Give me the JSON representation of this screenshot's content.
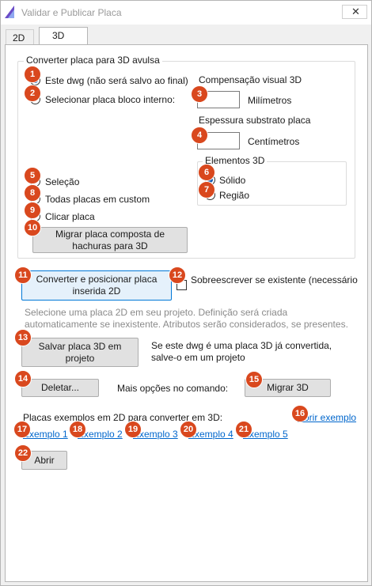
{
  "window": {
    "title": "Validar e Publicar Placa",
    "close_glyph": "✕",
    "icon": "app-triangle-icon"
  },
  "tabs": [
    {
      "label": "2D"
    },
    {
      "label": "3D"
    }
  ],
  "convert_group": {
    "legend": "Converter placa para 3D avulsa",
    "opt_this_dwg": "Este dwg (não será salvo ao final)",
    "opt_internal_block": "Selecionar placa bloco interno:",
    "visual_comp_label": "Compensação visual 3D",
    "visual_comp_value": "",
    "visual_comp_unit": "Milímetros",
    "substrate_label": "Espessura substrato placa",
    "substrate_value": "",
    "substrate_unit": "Centímetros",
    "elements_legend": "Elementos 3D",
    "opt_solid": "Sólido",
    "opt_region": "Região",
    "opt_selection": "Seleção",
    "opt_all_custom": "Todas placas em custom",
    "opt_click": "Clicar placa",
    "migrate_hatch_button": "Migrar placa composta de hachuras para 3D"
  },
  "convert_button": "Converter e posicionar placa inserida 2D",
  "overwrite_checkbox": "Sobreescrever se existente (necessário",
  "hint_text": "Selecione uma placa 2D em seu projeto. Definição será criada automaticamente se inexistente. Atributos serão considerados, se presentes.",
  "save_button": "Salvar placa 3D em projeto",
  "save_note": "Se este dwg é uma placa 3D já convertida, salve-o em um projeto",
  "delete_button": "Deletar...",
  "more_options_label": "Mais opções no comando:",
  "migrate3d_button": "Migrar 3D",
  "examples_label": "Placas exemplos em 2D para converter em 3D:",
  "open_example_link": "Abrir exemplo",
  "examples": [
    "Exemplo 1",
    "Exemplo 2",
    "Exemplo 3",
    "Exemplo 4",
    "Exemplo 5"
  ],
  "open_button": "Abrir",
  "badges": [
    "1",
    "2",
    "3",
    "4",
    "5",
    "6",
    "7",
    "8",
    "9",
    "10",
    "11",
    "12",
    "13",
    "14",
    "15",
    "16",
    "17",
    "18",
    "19",
    "20",
    "21",
    "22"
  ],
  "colors": {
    "badge": "#d9481e",
    "link": "#0066cc",
    "radio_checked": "#1a5fb4",
    "primary_border": "#0078d7"
  }
}
